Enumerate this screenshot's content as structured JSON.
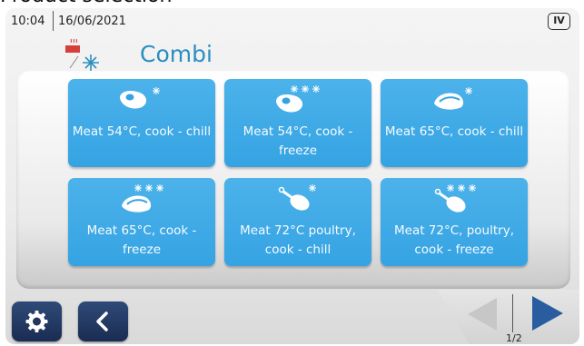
{
  "page_heading": "Product selection",
  "status": {
    "time": "10:04",
    "date": "16/06/2021",
    "level_badge": "IV"
  },
  "mode": {
    "title": "Combi",
    "icon": "combi-cook-chill-icon"
  },
  "tiles": [
    {
      "label": "Meat 54°C, cook - chill",
      "icon": "steak-icon",
      "suffix": "chill"
    },
    {
      "label": "Meat 54°C, cook - freeze",
      "icon": "steak-icon",
      "suffix": "freeze"
    },
    {
      "label": "Meat 65°C, cook - chill",
      "icon": "roast-icon",
      "suffix": "chill"
    },
    {
      "label": "Meat 65°C, cook - freeze",
      "icon": "roast-icon",
      "suffix": "freeze"
    },
    {
      "label": "Meat 72°C poultry, cook - chill",
      "icon": "drumstick-icon",
      "suffix": "chill"
    },
    {
      "label": "Meat 72°C, poultry, cook - freeze",
      "icon": "drumstick-icon",
      "suffix": "freeze"
    }
  ],
  "pagination": {
    "indicator": "1/2"
  },
  "colors": {
    "accent": "#2a8fbf",
    "tile": "#3aa6e5",
    "button_dark": "#22365e",
    "arrow_active": "#2a5d9f",
    "arrow_disabled": "#c7c7c7"
  }
}
